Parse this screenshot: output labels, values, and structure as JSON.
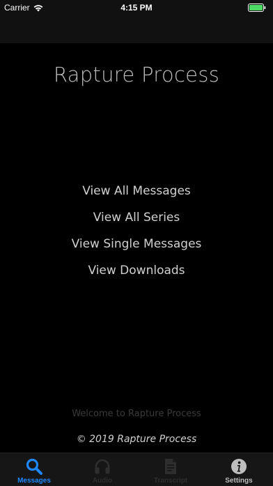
{
  "status_bar": {
    "carrier": "Carrier",
    "time": "4:15 PM"
  },
  "main": {
    "title": "Rapture Process",
    "menu": [
      {
        "label": "View All Messages"
      },
      {
        "label": "View All Series"
      },
      {
        "label": "View Single Messages"
      },
      {
        "label": "View Downloads"
      }
    ],
    "welcome": "Welcome to Rapture Process",
    "copyright": "© 2019 Rapture Process"
  },
  "tab_bar": {
    "tabs": [
      {
        "label": "Messages",
        "icon": "search-icon",
        "state": "active",
        "color": "#1e88ff"
      },
      {
        "label": "Audio",
        "icon": "headphones-icon",
        "state": "disabled",
        "color": "#2e2e2e"
      },
      {
        "label": "Transcript",
        "icon": "document-icon",
        "state": "disabled",
        "color": "#2e2e2e"
      },
      {
        "label": "Settings",
        "icon": "info-icon",
        "state": "normal",
        "color": "#bdbdbd"
      }
    ]
  },
  "colors": {
    "background": "#000000",
    "bar_background": "#111111",
    "accent": "#1e88ff",
    "battery": "#4cd964"
  }
}
